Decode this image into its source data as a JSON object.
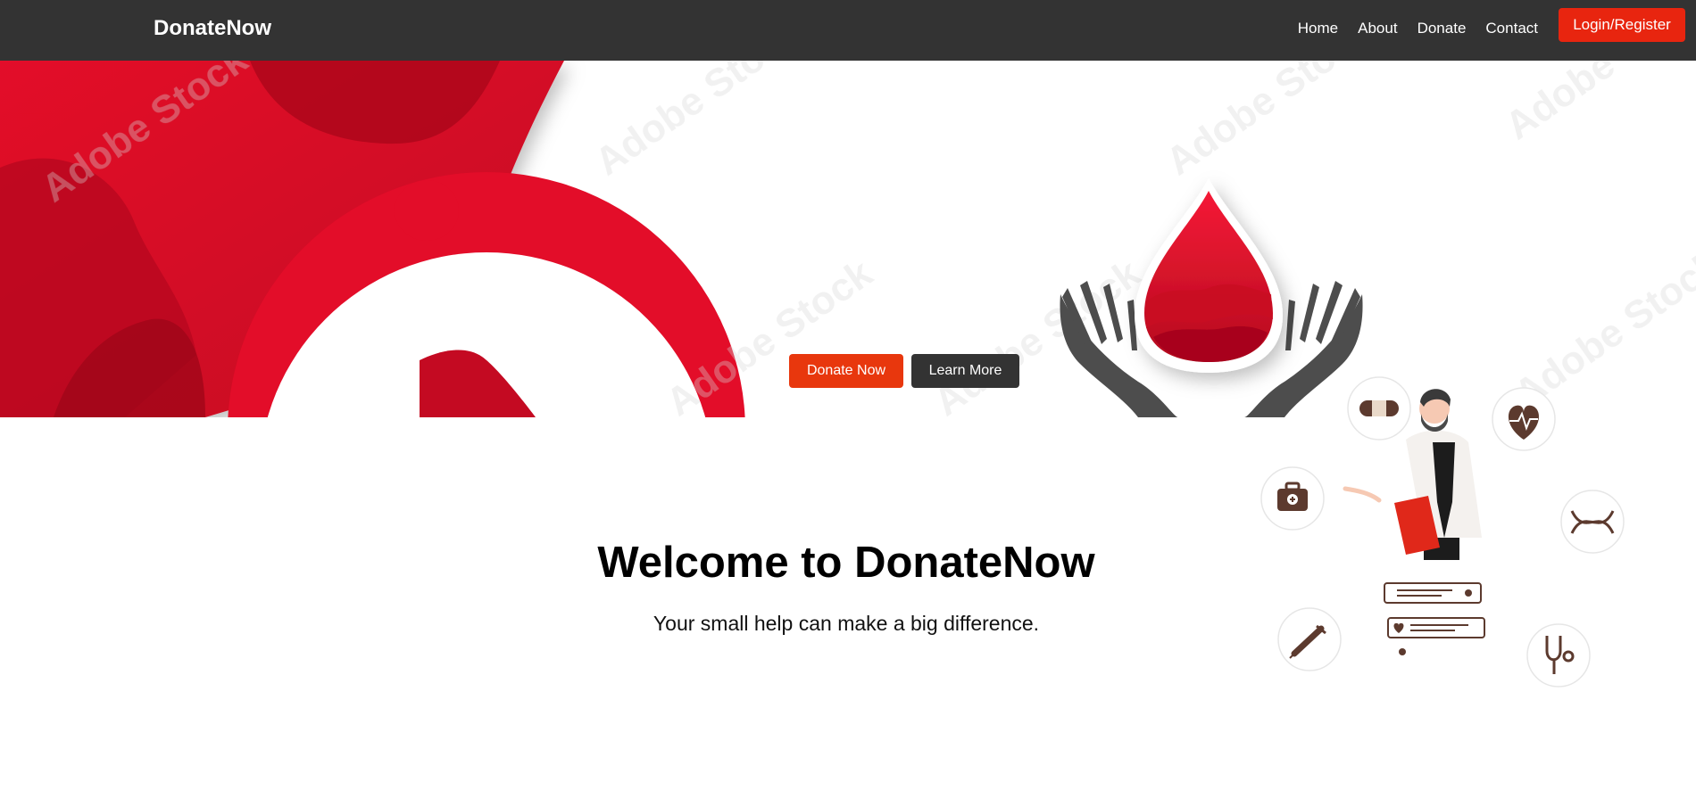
{
  "nav": {
    "brand": "DonateNow",
    "links": [
      "Home",
      "About",
      "Donate",
      "Contact"
    ],
    "login_label": "Login/Register"
  },
  "hero": {
    "donate_label": "Donate Now",
    "learn_label": "Learn More",
    "watermark": "Adobe Stock"
  },
  "main": {
    "title": "Welcome to DonateNow",
    "tagline": "Your small help can make a big difference."
  },
  "colors": {
    "navbar": "#333333",
    "accent": "#e8250f",
    "blood": "#e30d29",
    "blood_dark": "#a80519"
  },
  "icons": [
    "bandage-icon",
    "heart-pulse-icon",
    "medical-kit-icon",
    "dna-icon",
    "syringe-icon",
    "stethoscope-icon"
  ]
}
